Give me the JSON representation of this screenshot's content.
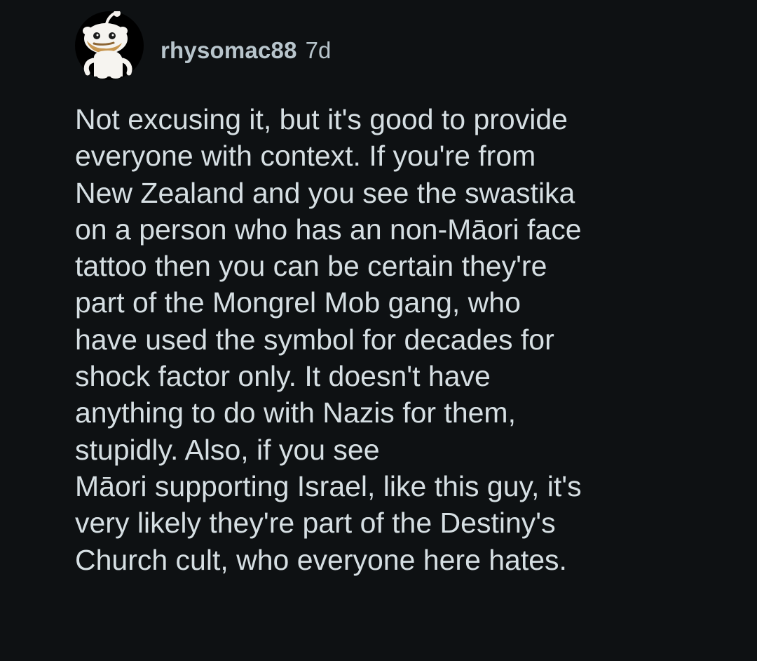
{
  "comment": {
    "username": "rhysomac88",
    "timestamp": "7d",
    "body_lines": [
      "Not excusing it, but it's good to provide",
      "everyone with context. If you're from",
      "New Zealand and you see the swastika",
      "on a person who has an non-Māori face",
      "tattoo then you can be certain they're",
      "part of the Mongrel Mob gang, who",
      "have used the symbol for decades for",
      "shock factor only. It doesn't have",
      "anything to do with Nazis for them,",
      "stupidly. Also, if you see",
      "Māori supporting Israel, like this guy, it's",
      "very likely they're part of the Destiny's",
      "Church cult, who everyone here hates."
    ]
  },
  "icons": {
    "avatar": "reddit-snoo-avatar-icon"
  },
  "colors": {
    "background": "#0e1113",
    "text": "#d6dfe3",
    "meta_text": "#b8c5cc"
  }
}
